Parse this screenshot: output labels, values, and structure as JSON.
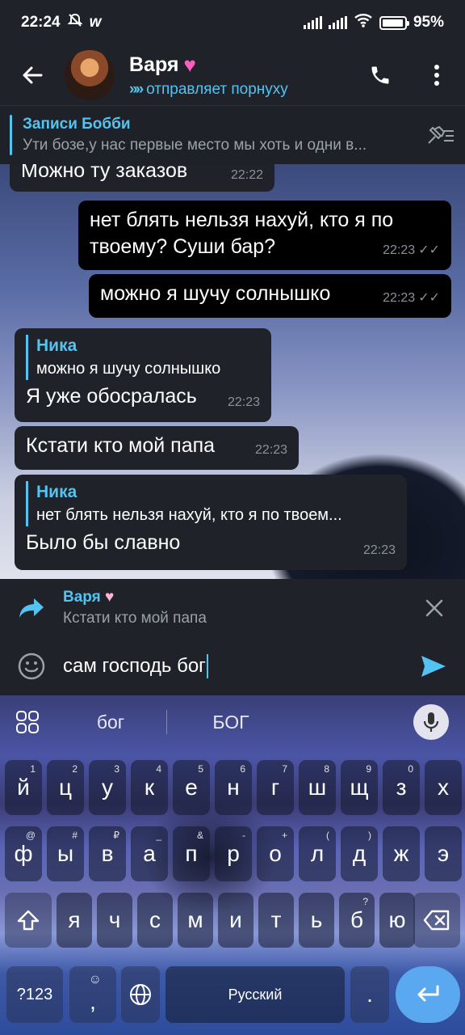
{
  "statusbar": {
    "time": "22:24",
    "battery": "95%",
    "battery_level": 0.95
  },
  "header": {
    "name": "Варя",
    "status": "отправляет порнуху"
  },
  "pinned": {
    "title": "Записи Бобби",
    "message": "Ути бозе,у нас первые место мы хоть и одни в..."
  },
  "messages": [
    {
      "text": "Можно ту заказов",
      "time": "22:22"
    },
    {
      "text": "нет блять нельзя нахуй, кто я по твоему? Суши бар?",
      "time": "22:23"
    },
    {
      "text": "можно я шучу солнышко",
      "time": "22:23"
    },
    {
      "reply_name": "Ника",
      "reply_text": "можно я шучу солнышко",
      "text": "Я уже обосралась",
      "time": "22:23"
    },
    {
      "text": "Кстати кто мой папа",
      "time": "22:23"
    },
    {
      "reply_name": "Ника",
      "reply_text": "нет блять нельзя нахуй, кто я по твоем...",
      "text": "Было бы славно",
      "time": "22:23"
    }
  ],
  "replybar": {
    "name": "Варя",
    "text": "Кстати кто мой папа"
  },
  "input": {
    "value": "сам господь бог"
  },
  "keyboard": {
    "suggestions": [
      "бог",
      "БОГ"
    ],
    "row1": [
      "й",
      "ц",
      "у",
      "к",
      "е",
      "н",
      "г",
      "ш",
      "щ",
      "з",
      "х"
    ],
    "row1_hints": [
      "1",
      "2",
      "3",
      "4",
      "5",
      "6",
      "7",
      "8",
      "9",
      "0",
      ""
    ],
    "row2": [
      "ф",
      "ы",
      "в",
      "а",
      "п",
      "р",
      "о",
      "л",
      "д",
      "ж",
      "э"
    ],
    "row2_hints": [
      "@",
      "#",
      "₽",
      "_",
      "&",
      "-",
      "+",
      "(",
      ")",
      "",
      ""
    ],
    "row3": [
      "я",
      "ч",
      "с",
      "м",
      "и",
      "т",
      "ь",
      "б",
      "ю"
    ],
    "row3_hints": [
      "",
      "",
      "",
      "",
      "",
      "",
      "",
      "?",
      ""
    ],
    "symbols_label": "?123",
    "comma": ",",
    "space_label": "Русский",
    "period": "."
  },
  "colors": {
    "accent": "#53c3f2",
    "bubble": "#1f2329",
    "bubble_out": "#000000",
    "enter": "#5aa8f0"
  }
}
